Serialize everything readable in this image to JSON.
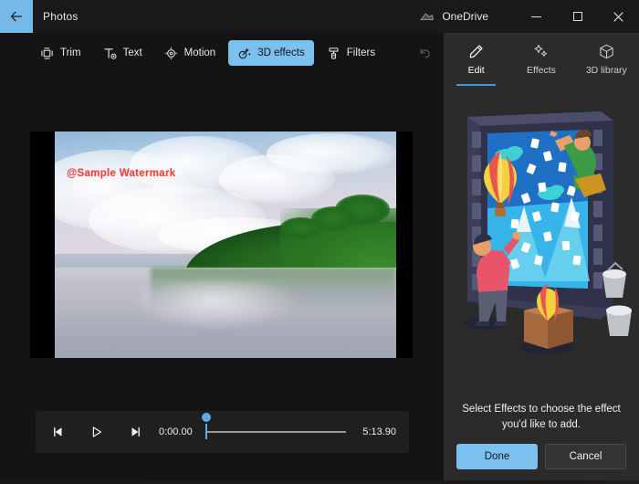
{
  "titlebar": {
    "back_icon": "back-arrow-icon",
    "app_title": "Photos",
    "onedrive_label": "OneDrive",
    "onedrive_icon": "onedrive-cloud-icon",
    "minimize_label": "Minimize",
    "maximize_label": "Maximize",
    "close_label": "Close",
    "back_bg": "#74b9e7",
    "bg": "#191919"
  },
  "toolbar": {
    "items": [
      {
        "label": "Trim",
        "icon": "trim-icon",
        "active": false,
        "disabled": false
      },
      {
        "label": "Text",
        "icon": "text-icon",
        "active": false,
        "disabled": false
      },
      {
        "label": "Motion",
        "icon": "motion-icon",
        "active": false,
        "disabled": false
      },
      {
        "label": "3D effects",
        "icon": "3d-effects-icon",
        "active": true,
        "disabled": false
      },
      {
        "label": "Filters",
        "icon": "filters-icon",
        "active": false,
        "disabled": false
      },
      {
        "label": "",
        "icon": "undo-icon",
        "active": false,
        "disabled": true
      },
      {
        "label": "",
        "icon": "redo-icon",
        "active": false,
        "disabled": true
      }
    ],
    "active_color": "#7cc0ef"
  },
  "video": {
    "watermark": "@Sample  Watermark",
    "watermark_color": "#f8403a",
    "letterbox_color": "#000000",
    "scene_description": "tropical beach with reflective wet sand, palm jungle on right, cloudy sky"
  },
  "player": {
    "prev_frame_icon": "previous-frame-icon",
    "play_icon": "play-icon",
    "next_frame_icon": "next-frame-icon",
    "current_time": "0:00.00",
    "total_time": "5:13.90",
    "playhead_percent": 0,
    "accent_color": "#5aaee8"
  },
  "panel": {
    "tabs": [
      {
        "label": "Edit",
        "icon": "pencil-icon",
        "active": true
      },
      {
        "label": "Effects",
        "icon": "sparkles-icon",
        "active": false
      },
      {
        "label": "3D library",
        "icon": "cube-icon",
        "active": false
      }
    ],
    "tab_underline_color": "#3f9ae0",
    "illustration_name": "effects-illustration",
    "message": "Select Effects to choose the effect you'd like to add.",
    "done_label": "Done",
    "cancel_label": "Cancel",
    "done_color": "#7cc0ef",
    "bg": "#2b2b2b"
  }
}
